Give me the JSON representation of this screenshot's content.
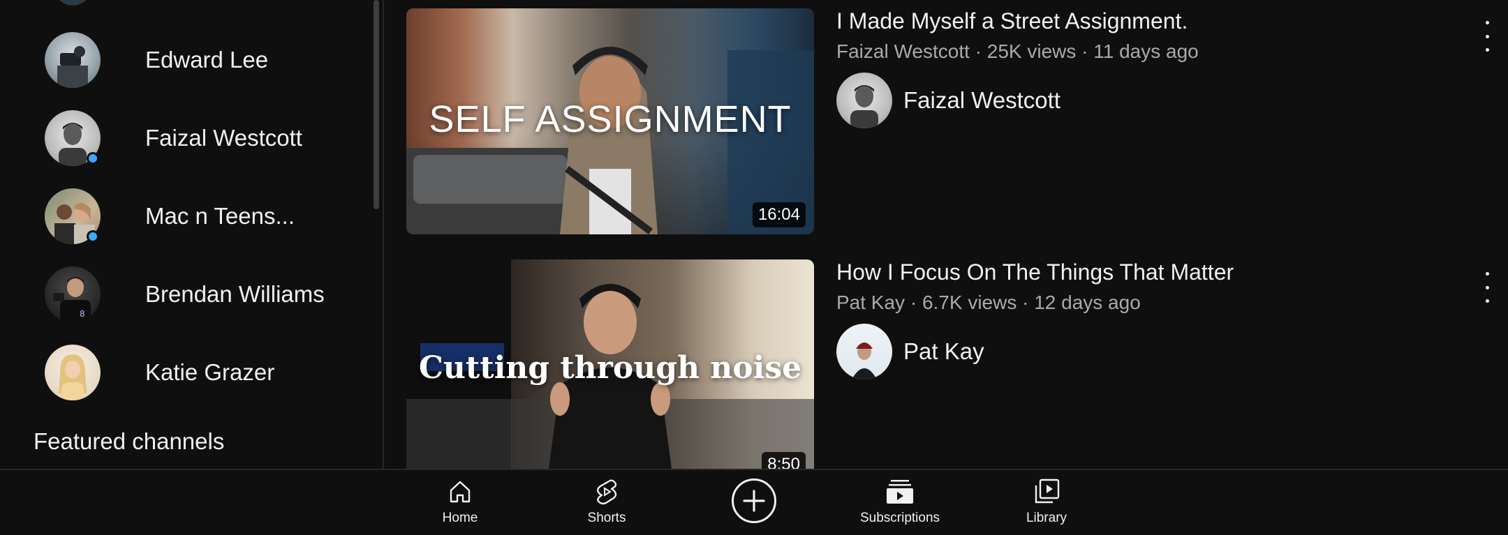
{
  "sidebar": {
    "subscriptions": [
      {
        "name": "Edward Lee",
        "new": false
      },
      {
        "name": "Faizal Westcott",
        "new": true
      },
      {
        "name": "Mac n Teens...",
        "new": true
      },
      {
        "name": "Brendan Williams",
        "new": false
      },
      {
        "name": "Katie Grazer",
        "new": false
      }
    ],
    "section_title": "Featured channels"
  },
  "feed": {
    "videos": [
      {
        "title": "I Made Myself a Street Assignment.",
        "meta": "Faizal Westcott · 25K views · 11 days ago",
        "channel": "Faizal Westcott",
        "thumbnail_text": "SELF ASSIGNMENT",
        "duration": "16:04"
      },
      {
        "title": "How I Focus On The Things That Matter",
        "meta": "Pat Kay · 6.7K views · 12 days ago",
        "channel": "Pat Kay",
        "thumbnail_text": "Cutting through noise",
        "duration": "8:50"
      }
    ]
  },
  "bottom_nav": {
    "home": "Home",
    "shorts": "Shorts",
    "create_icon": "plus-circle-icon",
    "subscriptions": "Subscriptions",
    "library": "Library"
  },
  "colors": {
    "background": "#0f0f0f",
    "text": "#f1f1f1",
    "secondary_text": "#aaaaaa",
    "new_dot": "#3ea6ff"
  }
}
